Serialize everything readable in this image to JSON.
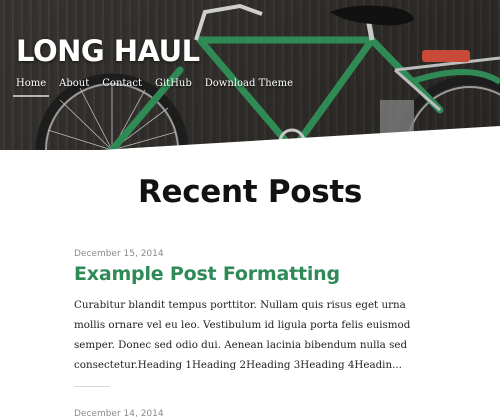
{
  "site": {
    "title": "LONG HAUL"
  },
  "nav": {
    "items": [
      "Home",
      "About",
      "Contact",
      "GitHub",
      "Download Theme"
    ],
    "active": "Home"
  },
  "main": {
    "heading": "Recent Posts",
    "posts": [
      {
        "date": "December 15, 2014",
        "title": "Example Post Formatting",
        "excerpt": "Curabitur blandit tempus porttitor. Nullam quis risus eget urna mollis ornare vel eu leo. Vestibulum id ligula porta felis euismod semper. Donec sed odio dui. Aenean lacinia bibendum nulla sed consectetur.Heading 1Heading 2Heading 3Heading 4Headin..."
      },
      {
        "date": "December 14, 2014"
      }
    ]
  },
  "colors": {
    "accent": "#2e8b57",
    "heading": "#111111",
    "date": "#8a8a8a",
    "body_text": "#222222"
  }
}
